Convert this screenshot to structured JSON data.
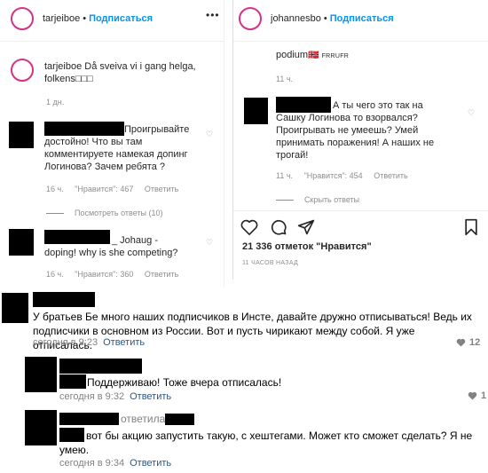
{
  "left_post": {
    "username": "tarjeiboe",
    "follow": "Подписаться",
    "caption_user": "tarjeiboe",
    "caption_text": "Då sveiva vi i gang helga, folkens",
    "caption_emoji": "□□□",
    "caption_age": "1 дн.",
    "comments": [
      {
        "text": "Проигрывайте достойно! Что вы там комментируете намекая допинг Логинова? Зачем ребята ?",
        "age": "16 ч.",
        "likes": "\"Нравится\": 467",
        "reply": "Ответить",
        "view_replies": "Посмотреть ответы (10)"
      },
      {
        "text_a": "_ Johaug -",
        "text_b": "doping! why is she competing?",
        "age": "16 ч.",
        "likes": "\"Нравится\": 360",
        "reply": "Ответить"
      }
    ]
  },
  "right_post": {
    "username": "johannesbo",
    "follow": "Подписаться",
    "top_text": "podium",
    "top_suffix": "FRRUFR",
    "top_age": "11 ч.",
    "comment": {
      "text_a": "А ты чего это так на",
      "text_b": "Сашку Логинова то взорвался? Проигрывать не умеешь? Умей принимать поражения! А наших не трогай!",
      "age": "11 ч.",
      "likes": "\"Нравится\": 454",
      "reply": "Ответить",
      "hide_replies": "Скрыть ответы"
    },
    "likes_count": "21 336 отметок \"Нравится\"",
    "time_ago": "11 ЧАСОВ НАЗАД"
  },
  "vk_comments": [
    {
      "text": "У братьев Бе много наших подписчиков в Инсте, давайте дружно отписываться! Ведь их подписчики в основном из России. Вот и пусть чирикают между собой. Я уже отписалась.",
      "time": "сегодня в 9:23",
      "reply": "Ответить",
      "likes": "12"
    },
    {
      "text": "Поддерживаю! Тоже вчера отписалась!",
      "time": "сегодня в 9:32",
      "reply": "Ответить",
      "likes": "1"
    },
    {
      "replied_label": "ответила",
      "text": "вот бы акцию запустить такую, с хештегами. Может кто сможет сделать? Я не умею.",
      "time": "сегодня в 9:34",
      "reply": "Ответить"
    }
  ]
}
